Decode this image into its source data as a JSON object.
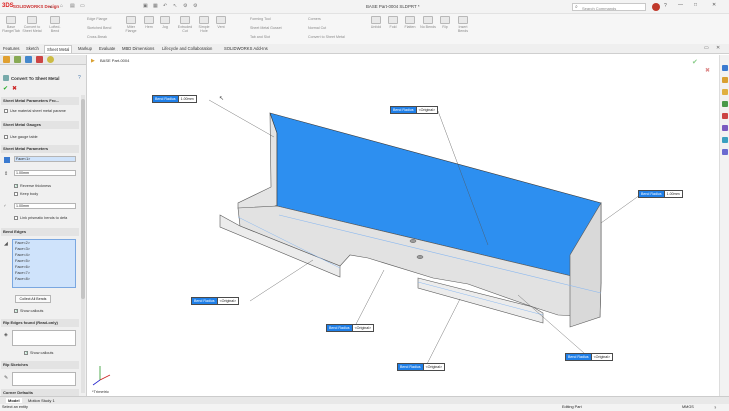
{
  "titlebar": {
    "logo": "SOLIDWORKS Design",
    "logo_brand": "3DS",
    "doc_title": "BASE Part-0004 SLDPRT *",
    "search_placeholder": "Search Commands",
    "help": "?",
    "min": "—",
    "max": "□",
    "close": "✕"
  },
  "ribbon": {
    "buttons": [
      {
        "label": "Base Flange/Tab",
        "icon": "base-flange-icon"
      },
      {
        "label": "Convert to Sheet Metal",
        "icon": "convert-sheet-metal-icon"
      },
      {
        "label": "Lofted-Bend",
        "icon": "lofted-bend-icon"
      },
      {
        "label": "Miter Flange",
        "icon": "miter-flange-icon"
      },
      {
        "label": "Hem",
        "icon": "hem-icon"
      },
      {
        "label": "Jog",
        "icon": "jog-icon"
      },
      {
        "label": "Extruded Cut",
        "icon": "extruded-cut-icon"
      },
      {
        "label": "Simple Hole",
        "icon": "simple-hole-icon"
      },
      {
        "label": "Vent",
        "icon": "vent-icon"
      },
      {
        "label": "Unfold",
        "icon": "unfold-icon"
      },
      {
        "label": "Fold",
        "icon": "fold-icon"
      },
      {
        "label": "Flatten",
        "icon": "flatten-icon"
      },
      {
        "label": "No Bends",
        "icon": "no-bends-icon"
      },
      {
        "label": "Rip",
        "icon": "rip-icon"
      },
      {
        "label": "Insert Bends",
        "icon": "insert-bends-icon"
      }
    ],
    "small_items": [
      "Edge Flange",
      "Sketched Bend",
      "Cross-Break",
      "Forming Tool",
      "Sheet Metal Gusset",
      "Tab and Slot",
      "Corners",
      "Normal Cut",
      "Convert to Sheet Metal"
    ]
  },
  "command_tabs": [
    "Features",
    "Sketch",
    "Sheet Metal",
    "Markup",
    "Evaluate",
    "MBD Dimensions",
    "Lifecycle and Collaboration",
    "SOLIDWORKS Add-Ins"
  ],
  "active_tab": "Sheet Metal",
  "panel": {
    "title": "Convert To Sheet Metal",
    "ok": "✔",
    "cancel": "✖",
    "sec_params_from": "Sheet Metal Parameters Fro...",
    "use_material_params": "Use material sheet metal parame",
    "sec_gauges": "Sheet Metal Gauges",
    "use_gauge_table": "Use gauge table",
    "sec_params": "Sheet Metal Parameters",
    "fixed_face": "Face<1>",
    "thickness": "1.00mm",
    "reverse_thickness": "Reverse thickness",
    "keep_body": "Keep body",
    "bend_radius": "1.00mm",
    "link_radius": "Link prismatic bends to defa",
    "sec_bend_edges": "Bend Edges",
    "bend_edges": [
      "Face<2>",
      "Face<3>",
      "Face<4>",
      "Face<5>",
      "Face<6>",
      "Face<7>",
      "Face<8>"
    ],
    "collect_all_bends": "Collect All Bends",
    "show_callouts": "Show callouts",
    "sec_rip_edges": "Rip Edges found (Read-only)",
    "show_callouts2": "Show callouts",
    "sec_rip_sketches": "Rip Sketches",
    "sec_corner_defaults": "Corner Defaults"
  },
  "viewport": {
    "tree_item": "BASE Part-0004",
    "view_label": "*Trimetric",
    "callouts": [
      {
        "label": "Bend Radius",
        "value": "1.00mm"
      },
      {
        "label": "Bend Radius",
        "value": "<Original>"
      },
      {
        "label": "Bend Radius",
        "value": "1.00mm"
      },
      {
        "label": "Bend Radius",
        "value": "<Original>"
      },
      {
        "label": "Bend Radius",
        "value": "<Original>"
      },
      {
        "label": "Bend Radius",
        "value": "<Original>"
      },
      {
        "label": "Bend Radius",
        "value": "<Original>"
      }
    ]
  },
  "bottom_tabs": [
    "Model",
    "Motion Study 1"
  ],
  "status": {
    "left": "Select an entity",
    "mid": "Editing Part",
    "right": "MMGS"
  },
  "colors": {
    "accent": "#1f7fe8",
    "face_highlight": "#2d8ff0",
    "part_grey": "#e6e6e6"
  }
}
